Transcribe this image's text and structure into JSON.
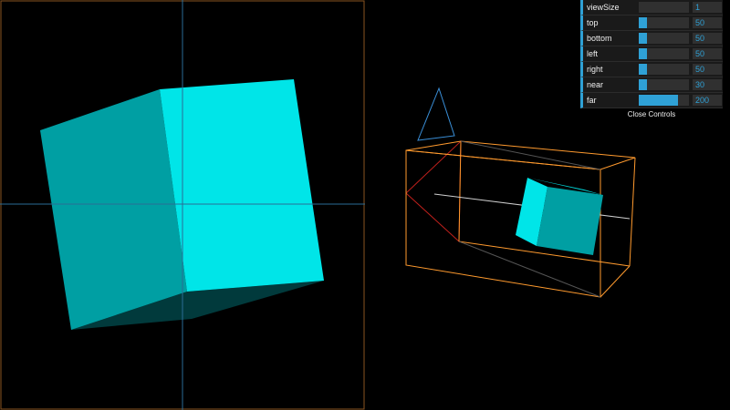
{
  "controls": [
    {
      "label": "viewSize",
      "value": "1",
      "fill": 0
    },
    {
      "label": "top",
      "value": "50",
      "fill": 0.16
    },
    {
      "label": "bottom",
      "value": "50",
      "fill": 0.16
    },
    {
      "label": "left",
      "value": "50",
      "fill": 0.16
    },
    {
      "label": "right",
      "value": "50",
      "fill": 0.16
    },
    {
      "label": "near",
      "value": "30",
      "fill": 0.16
    },
    {
      "label": "far",
      "value": "200",
      "fill": 0.78
    }
  ],
  "close_label": "Close Controls",
  "colors": {
    "background": "#000000",
    "cube_light": "#00e5e8",
    "cube_dark": "#009fa3",
    "frustum": "#ff9a2e",
    "camera_helper_blue": "#3a8fd8",
    "crosshair": "#2a6d96",
    "gui_accent": "#2fa1d6"
  }
}
